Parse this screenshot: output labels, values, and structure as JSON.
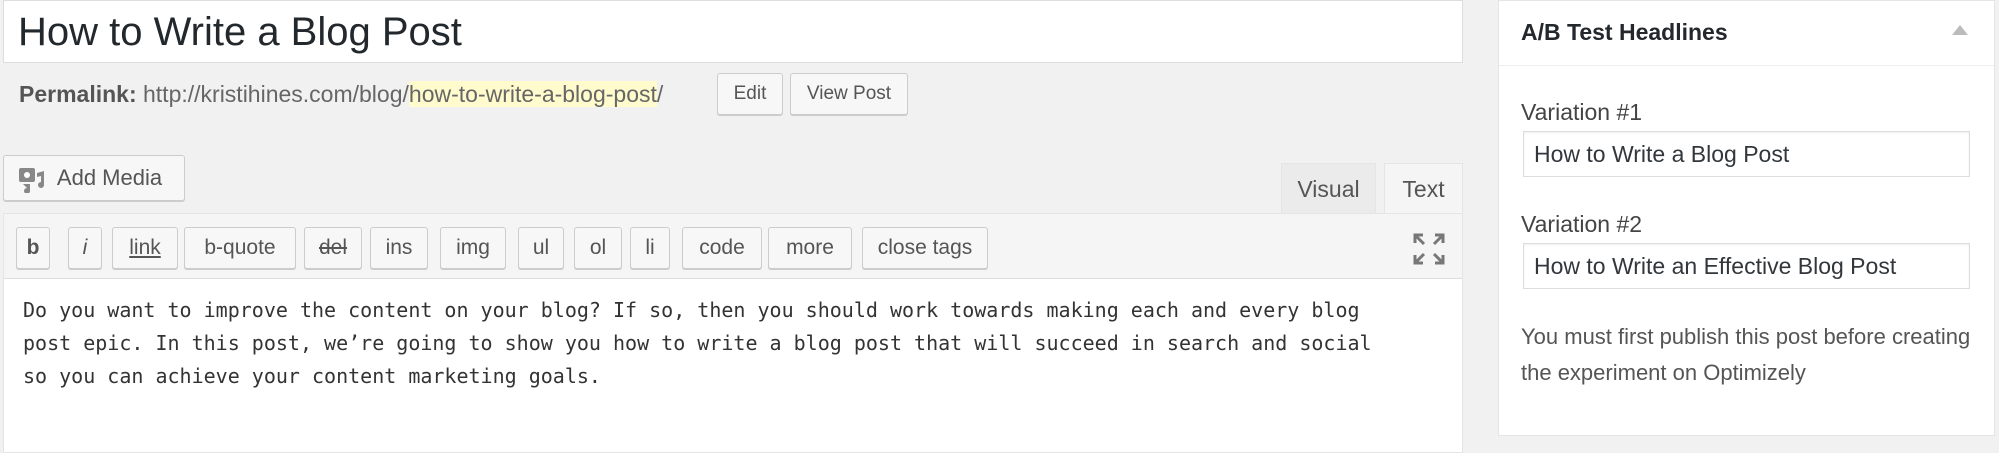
{
  "post": {
    "title": "How to Write a Blog Post",
    "permalink_label": "Permalink:",
    "permalink_base": "http://kristihines.com/blog/",
    "permalink_slug": "how-to-write-a-blog-post",
    "permalink_end": "/",
    "edit_label": "Edit",
    "view_label": "View Post"
  },
  "media": {
    "add_media_label": "Add Media",
    "icon": "media-icon"
  },
  "tabs": {
    "visual": "Visual",
    "text": "Text",
    "active": "Text"
  },
  "quicktags": [
    "b",
    "i",
    "link",
    "b-quote",
    "del",
    "ins",
    "img",
    "ul",
    "ol",
    "li",
    "code",
    "more",
    "close tags"
  ],
  "editor": {
    "content": "Do you want to improve the content on your blog? If so, then you should work towards making each and every blog\npost epic. In this post, we’re going to show you how to write a blog post that will succeed in search and social\nso you can achieve your content marketing goals."
  },
  "ab_test": {
    "title": "A/B Test Headlines",
    "variation1_label": "Variation #1",
    "variation1_value": "How to Write a Blog Post",
    "variation2_label": "Variation #2",
    "variation2_value": "How to Write an Effective Blog Post",
    "note": "You must first publish this post before creating the experiment on Optimizely"
  }
}
